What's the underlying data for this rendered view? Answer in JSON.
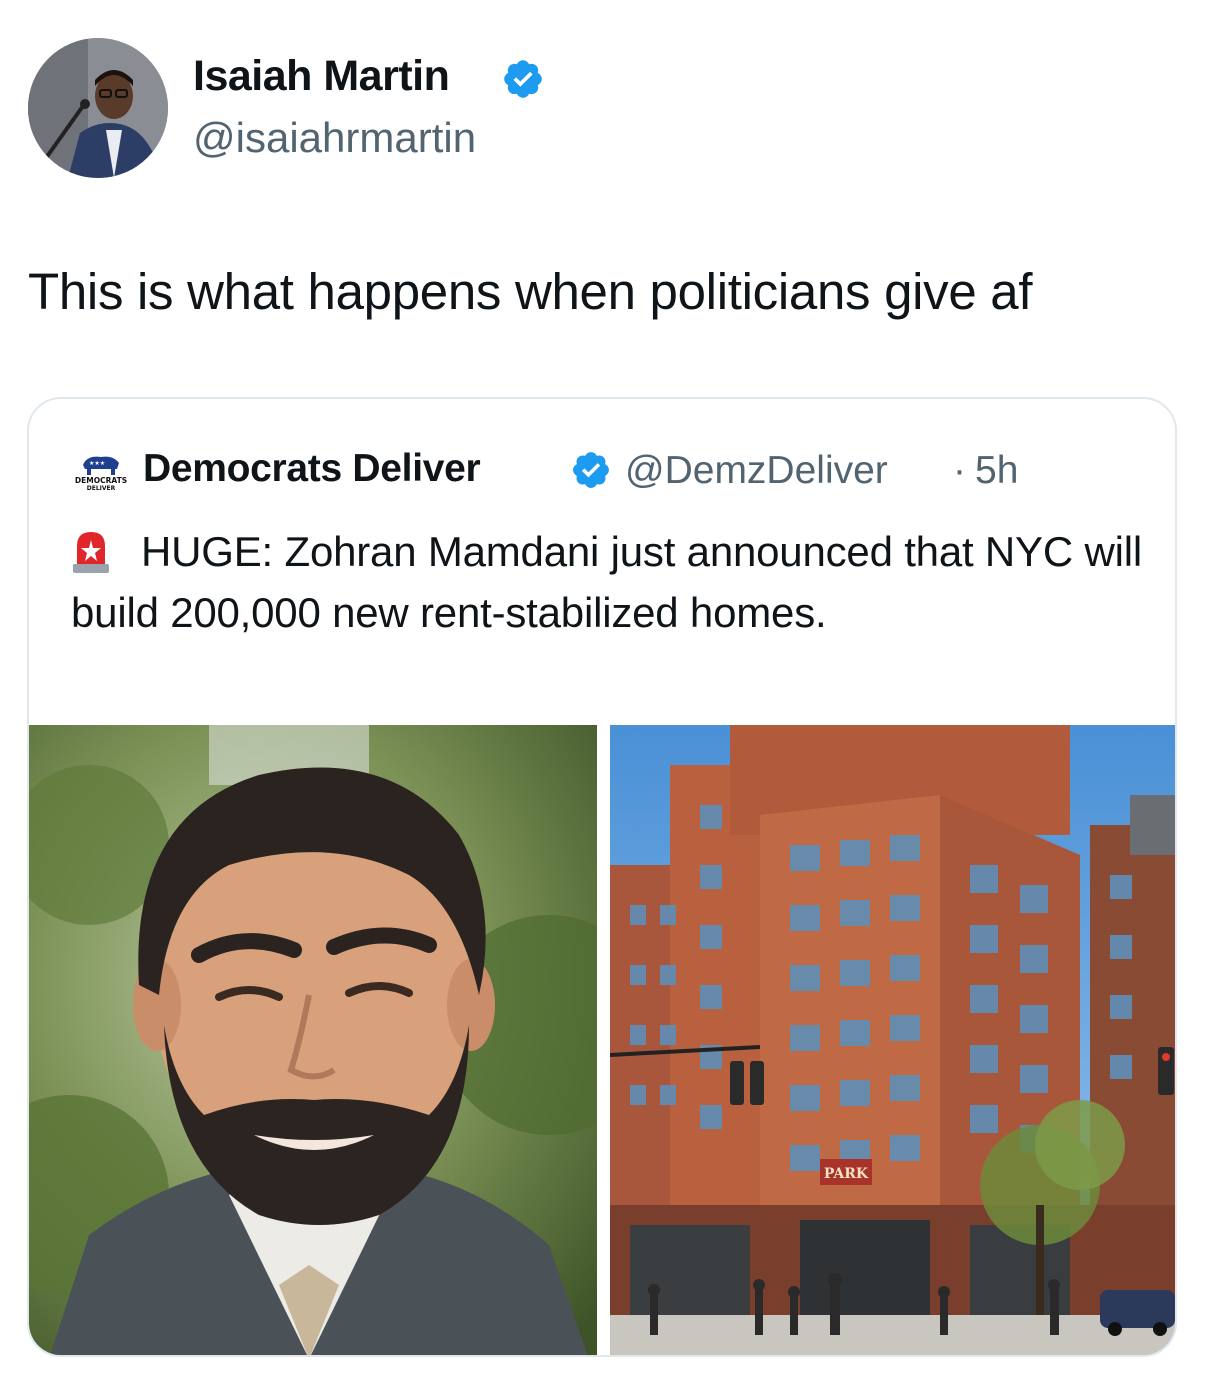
{
  "tweet": {
    "author_name": "Isaiah Martin",
    "author_handle": "@isaiahrmartin",
    "text": "This is what happens when politicians give af"
  },
  "quote": {
    "author_name": "Democrats Deliver",
    "author_handle": "@DemzDeliver",
    "separator": "·",
    "time": "5h",
    "avatar_logo_text": "DEMOCRATS DELIVER",
    "text": "HUGE: Zohran Mamdani just announced that NYC will build 200,000 new rent-stabilized homes."
  },
  "media": {
    "images": [
      {
        "description_icon": "portrait-photo"
      },
      {
        "description_icon": "apartment-building-photo",
        "sign_text": "PARK"
      }
    ]
  },
  "colors": {
    "verified": "#1d9bf0",
    "secondary_text": "#536471",
    "border": "#e1e8ed"
  }
}
